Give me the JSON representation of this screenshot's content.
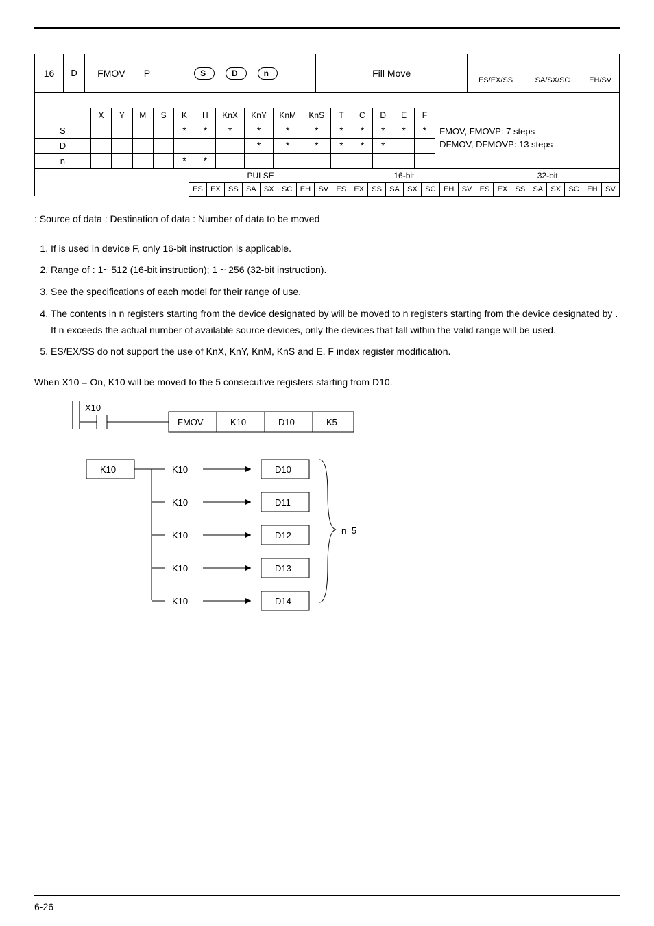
{
  "hdr": {
    "api": "16",
    "mnemonic_left": "D",
    "mnemonic_name": "FMOV",
    "mnemonic_p": "P",
    "funcdesc": "Fill Move",
    "controllers": [
      "ES/EX/SS",
      "SA/SX/SC",
      "EH/SV"
    ]
  },
  "operand_pills": [
    "S",
    "D",
    "n"
  ],
  "types": {
    "cols": [
      "X",
      "Y",
      "M",
      "S",
      "K",
      "H",
      "KnX",
      "KnY",
      "KnM",
      "KnS",
      "T",
      "C",
      "D",
      "E",
      "F"
    ]
  },
  "rows": [
    {
      "label": "S",
      "cells": [
        "",
        "",
        "",
        "",
        "*",
        "*",
        "*",
        "*",
        "*",
        "*",
        "*",
        "*",
        "*",
        "*",
        "*"
      ]
    },
    {
      "label": "D",
      "cells": [
        "",
        "",
        "",
        "",
        "",
        "",
        "",
        "*",
        "*",
        "*",
        "*",
        "*",
        "*",
        "",
        ""
      ]
    },
    {
      "label": "n",
      "cells": [
        "",
        "",
        "",
        "",
        "*",
        "*",
        "",
        "",
        "",
        "",
        "",
        "",
        "",
        "",
        ""
      ]
    }
  ],
  "steps": [
    "FMOV, FMOVP: 7 steps",
    "DFMOV, DFMOVP: 13 steps"
  ],
  "foot": {
    "hdrs": [
      "PULSE",
      "16-bit",
      "32-bit"
    ],
    "cells": [
      "ES",
      "EX",
      "SS",
      "SA",
      "SX",
      "SC",
      "EH",
      "SV",
      "ES",
      "EX",
      "SS",
      "SA",
      "SX",
      "SC",
      "EH",
      "SV",
      "ES",
      "EX",
      "SS",
      "SA",
      "SX",
      "SC",
      "EH",
      "SV"
    ]
  },
  "defs": " : Source of data     : Destination of data     : Number of data to be moved",
  "explanations": [
    "If   is used in device F, only 16-bit instruction is applicable.",
    "Range of   : 1~ 512 (16-bit instruction); 1 ~ 256 (32-bit instruction).",
    "See the specifications of each model for their range of use.",
    "The contents in n registers starting from the device designated by    will be moved to n registers starting from the device designated by   . If n exceeds the actual number of available source devices, only the devices that fall within the valid range will be used.",
    "ES/EX/SS do not support the use of KnX, KnY, KnM, KnS and E, F index register modification."
  ],
  "example_text": "When X10 = On, K10 will be moved to the 5 consecutive registers starting from D10.",
  "diagram": {
    "x_label": "X10",
    "ladder": [
      "FMOV",
      "K10",
      "D10",
      "K5"
    ],
    "src_box": "K10",
    "src_vals": [
      "K10",
      "K10",
      "K10",
      "K10",
      "K10"
    ],
    "dst_vals": [
      "D10",
      "D11",
      "D12",
      "D13",
      "D14"
    ],
    "brace_label": "n=5"
  },
  "page_no": "6-26"
}
